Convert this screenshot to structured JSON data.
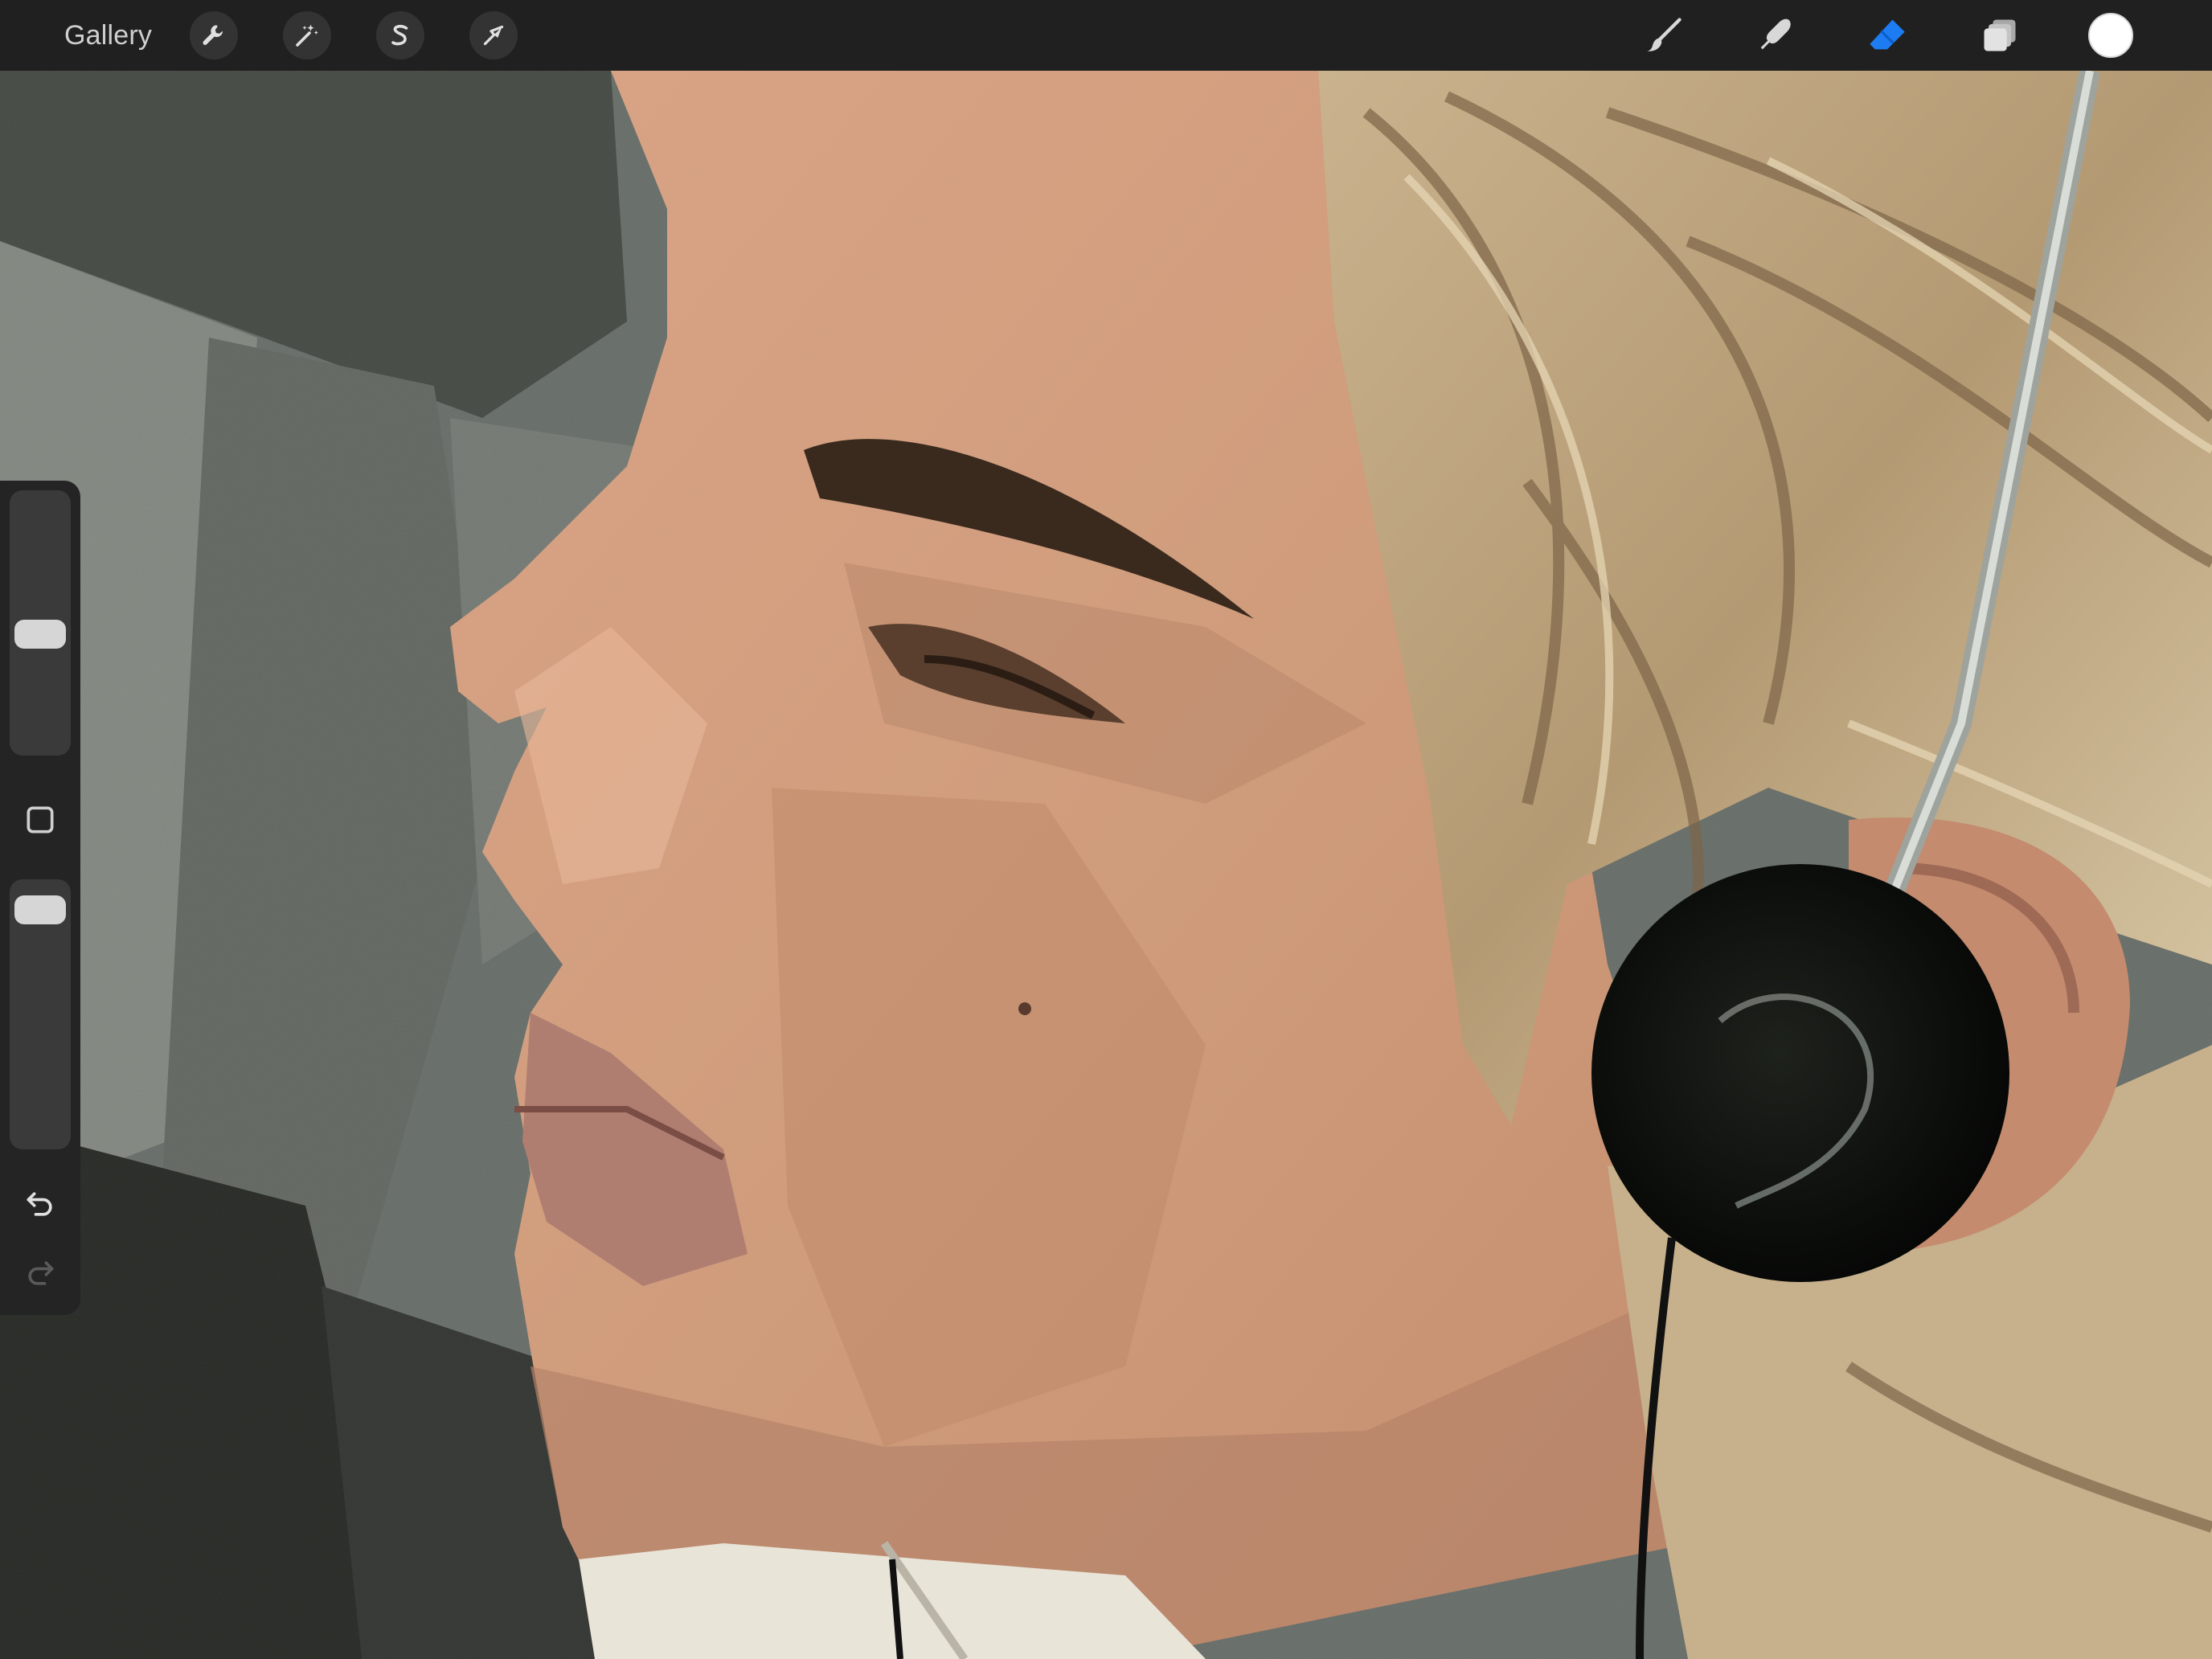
{
  "toolbar": {
    "gallery_label": "Gallery",
    "left_tools": [
      {
        "name": "actions",
        "icon": "wrench-icon"
      },
      {
        "name": "adjustments",
        "icon": "magic-wand-icon"
      },
      {
        "name": "selection",
        "icon": "selection-s-icon"
      },
      {
        "name": "transform",
        "icon": "arrow-cursor-icon"
      }
    ],
    "right_tools": [
      {
        "name": "brush",
        "icon": "brush-icon",
        "active": false
      },
      {
        "name": "smudge",
        "icon": "smudge-finger-icon",
        "active": false
      },
      {
        "name": "eraser",
        "icon": "eraser-icon",
        "active": true
      },
      {
        "name": "layers",
        "icon": "layers-icon",
        "active": false
      }
    ],
    "current_color": "#ffffff",
    "accent_color": "#1e7cf2"
  },
  "sidebar": {
    "brush_size_level": 0.55,
    "opacity_level": 0.05,
    "modify_button_icon": "square-icon",
    "undo_icon": "undo-arrow-icon",
    "redo_icon": "redo-arrow-icon",
    "redo_enabled": false
  }
}
